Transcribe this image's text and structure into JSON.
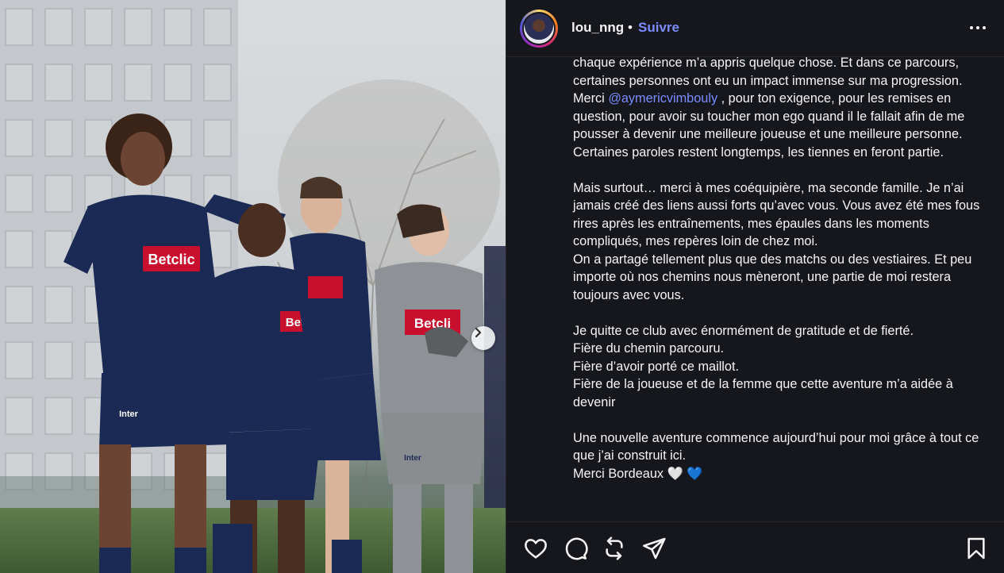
{
  "post": {
    "username": "lou_nng",
    "separator": "•",
    "follow_label": "Suivre",
    "avatar_icon": "profile-avatar",
    "accent_color": "#7b8cff"
  },
  "caption": {
    "p1": "chaque expérience m’a appris quelque chose. Et dans ce parcours, certaines personnes ont eu un impact immense sur ma progression.",
    "p2_prefix": "Merci ",
    "p2_mention": "@aymericvimbouly",
    "p2_rest": " , pour ton exigence, pour les remises en question, pour avoir su toucher mon ego quand il le fallait afin de me pousser à devenir une meilleure joueuse et une meilleure personne. Certaines paroles restent longtemps, les tiennes en feront partie.",
    "p3": "Mais surtout… merci à mes coéquipière, ma seconde famille. Je n’ai jamais créé des liens aussi forts qu’avec vous. Vous avez été mes fous rires après les entraînements, mes épaules dans les moments compliqués, mes repères loin de chez moi.",
    "p4": "On a partagé tellement plus que des matchs ou des vestiaires. Et peu importe où nos chemins nous mèneront, une partie de moi restera toujours avec vous.",
    "p5": "Je quitte ce club avec énormément de gratitude et de fierté.",
    "p6": "Fière du chemin parcouru.",
    "p7": "Fière d’avoir porté ce maillot.",
    "p8": "Fière de la joueuse et de la femme que cette aventure m’a aidée à devenir",
    "p9": "Une nouvelle aventure commence aujourd’hui pour moi grâce à tout ce que j’ai construit ici.",
    "p10": "Merci Bordeaux 🤍 💙"
  },
  "photo": {
    "sponsor_main": "Betclic",
    "sponsor_shorts": "Intermarché",
    "next_icon": "chevron-right-icon"
  },
  "actions": {
    "like_icon": "heart-icon",
    "comment_icon": "comment-icon",
    "repost_icon": "repost-icon",
    "share_icon": "send-icon",
    "save_icon": "bookmark-icon"
  }
}
